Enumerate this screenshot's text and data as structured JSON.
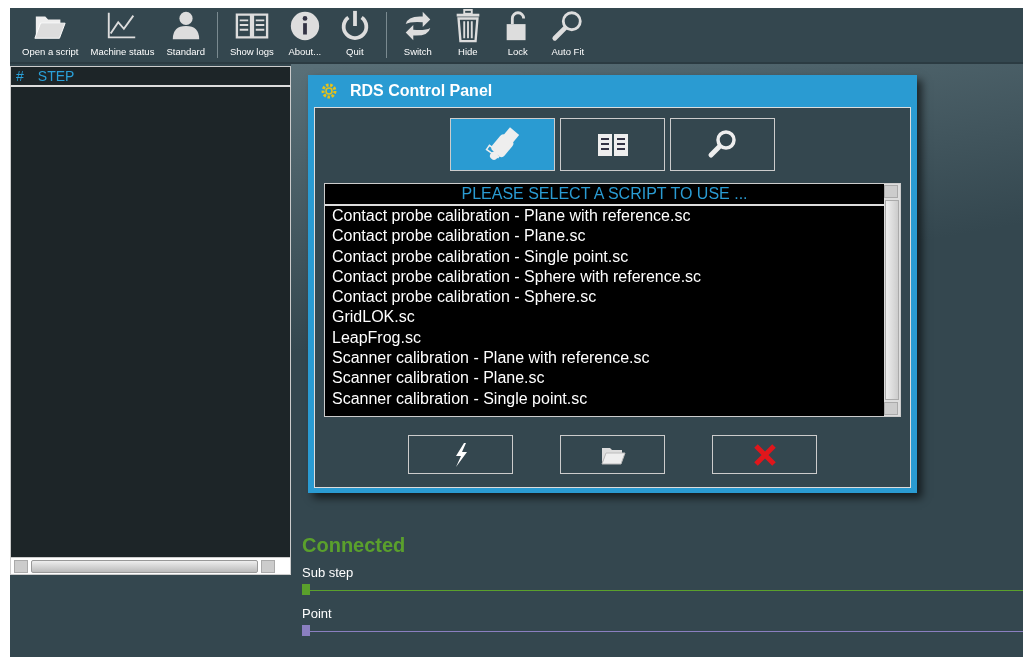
{
  "toolbar": {
    "groups": [
      [
        {
          "label": "Open a script"
        },
        {
          "label": "Machine status"
        },
        {
          "label": "Standard"
        }
      ],
      [
        {
          "label": "Show logs"
        },
        {
          "label": "About..."
        },
        {
          "label": "Quit"
        }
      ],
      [
        {
          "label": "Switch"
        },
        {
          "label": "Hide"
        },
        {
          "label": "Lock"
        },
        {
          "label": "Auto Fit"
        }
      ]
    ]
  },
  "step_panel": {
    "columns": [
      "#",
      "STEP"
    ]
  },
  "dialog": {
    "title": "RDS Control Panel",
    "tabs": [
      {
        "selected": true
      },
      {
        "selected": false
      },
      {
        "selected": false
      }
    ],
    "list_header": "PLEASE SELECT A SCRIPT TO USE ...",
    "scripts": [
      "Contact probe calibration - Plane with reference.sc",
      "Contact probe calibration - Plane.sc",
      "Contact probe calibration - Single point.sc",
      "Contact probe calibration - Sphere with reference.sc",
      "Contact probe calibration - Sphere.sc",
      "GridLOK.sc",
      "LeapFrog.sc",
      "Scanner calibration - Plane with reference.sc",
      "Scanner calibration - Plane.sc",
      "Scanner calibration - Single point.sc"
    ]
  },
  "status": "Connected",
  "sliders": [
    {
      "label": "Sub step",
      "level": 0,
      "color": "#5aa02c"
    },
    {
      "label": "Point",
      "level": 0,
      "color": "#8a7fc0"
    }
  ]
}
